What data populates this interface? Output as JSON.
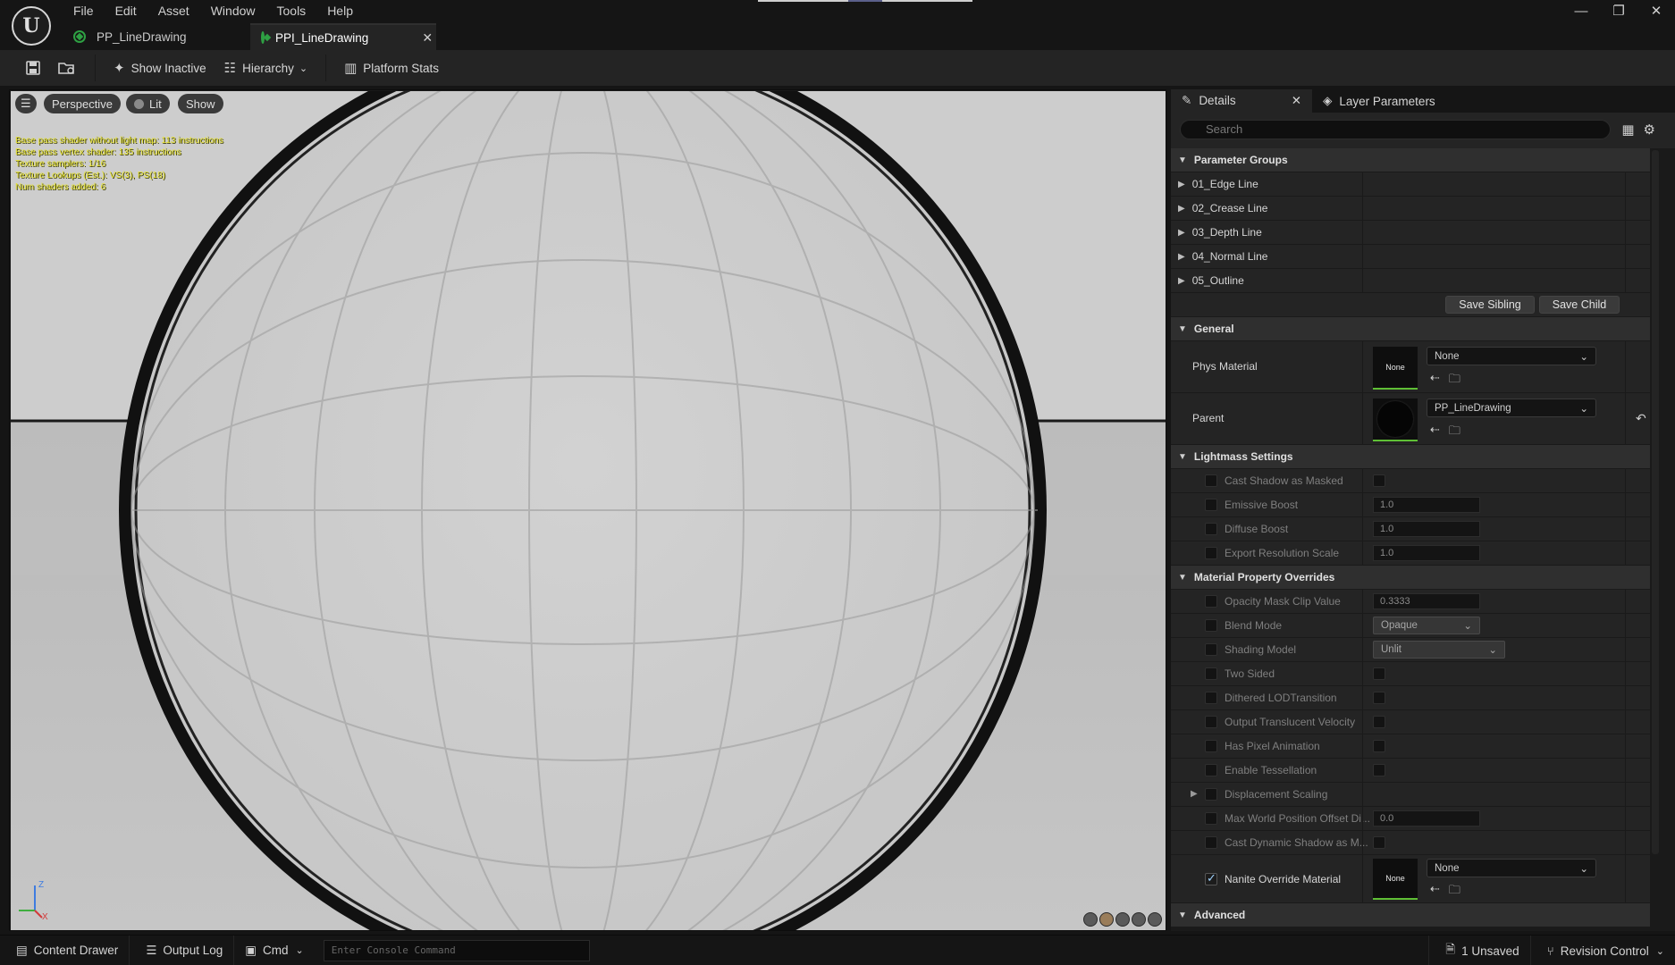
{
  "menu": [
    "File",
    "Edit",
    "Asset",
    "Window",
    "Tools",
    "Help"
  ],
  "tabs": [
    {
      "label": "PP_LineDrawing",
      "active": false
    },
    {
      "label": "PPI_LineDrawing",
      "active": true
    }
  ],
  "toolbar": {
    "show_inactive": "Show Inactive",
    "hierarchy": "Hierarchy",
    "platform_stats": "Platform Stats"
  },
  "viewport": {
    "perspective": "Perspective",
    "lit": "Lit",
    "show": "Show",
    "stats": [
      "Base pass shader without light map: 113 instructions",
      "Base pass vertex shader: 135 instructions",
      "Texture samplers: 1/16",
      "Texture Lookups (Est.): VS(3), PS(18)",
      "Num shaders added: 6"
    ],
    "axis_labels": {
      "z": "Z",
      "x": "X"
    }
  },
  "details": {
    "tab_details": "Details",
    "tab_layer": "Layer Parameters",
    "search_placeholder": "Search",
    "parameter_groups": {
      "title": "Parameter Groups",
      "items": [
        "01_Edge Line",
        "02_Crease Line",
        "03_Depth Line",
        "04_Normal Line",
        "05_Outline"
      ],
      "save_sibling": "Save Sibling",
      "save_child": "Save Child"
    },
    "general": {
      "title": "General",
      "phys_material_label": "Phys Material",
      "phys_material_thumb": "None",
      "phys_material_value": "None",
      "parent_label": "Parent",
      "parent_value": "PP_LineDrawing"
    },
    "lightmass": {
      "title": "Lightmass Settings",
      "cast_shadow_masked": "Cast Shadow as Masked",
      "emissive_boost": "Emissive Boost",
      "emissive_boost_value": "1.0",
      "diffuse_boost": "Diffuse Boost",
      "diffuse_boost_value": "1.0",
      "export_resolution": "Export Resolution Scale",
      "export_resolution_value": "1.0"
    },
    "overrides": {
      "title": "Material Property Overrides",
      "opacity_mask": "Opacity Mask Clip Value",
      "opacity_mask_value": "0.3333",
      "blend_mode": "Blend Mode",
      "blend_mode_value": "Opaque",
      "shading_model": "Shading Model",
      "shading_model_value": "Unlit",
      "two_sided": "Two Sided",
      "dithered": "Dithered LODTransition",
      "translucent_velocity": "Output Translucent Velocity",
      "pixel_animation": "Has Pixel Animation",
      "tessellation": "Enable Tessellation",
      "displacement": "Displacement Scaling",
      "max_wpo": "Max World Position Offset Di...",
      "max_wpo_value": "0.0",
      "cast_dynamic": "Cast Dynamic Shadow as M...",
      "nanite": "Nanite Override Material",
      "nanite_thumb": "None",
      "nanite_value": "None"
    },
    "advanced": "Advanced"
  },
  "statusbar": {
    "content_drawer": "Content Drawer",
    "output_log": "Output Log",
    "cmd": "Cmd",
    "console_placeholder": "Enter Console Command",
    "unsaved": "1 Unsaved",
    "revision_control": "Revision Control"
  },
  "colors": {
    "accent_green": "#5fbf35",
    "stats_yellow": "#e7e335",
    "panel_bg": "#242424"
  }
}
